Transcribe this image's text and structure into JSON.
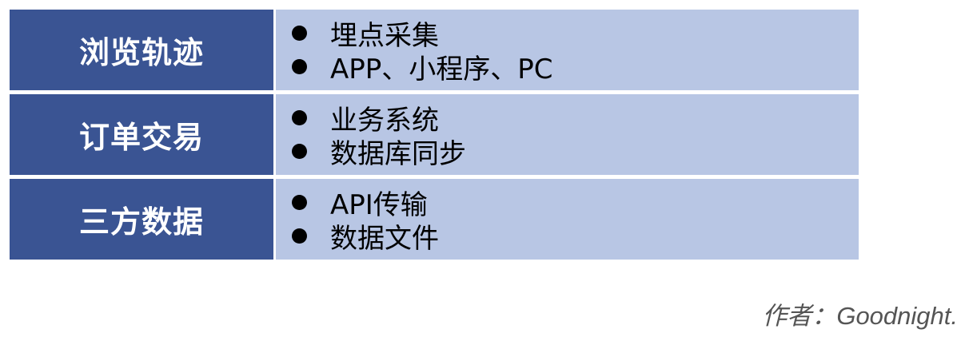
{
  "rows": [
    {
      "category": "浏览轨迹",
      "items": [
        "埋点采集",
        "APP、小程序、PC"
      ]
    },
    {
      "category": "订单交易",
      "items": [
        "业务系统",
        "数据库同步"
      ]
    },
    {
      "category": "三方数据",
      "items": [
        "API传输",
        "数据文件"
      ]
    }
  ],
  "author": "作者：Goodnight.",
  "colors": {
    "category_bg": "#3a5493",
    "items_bg": "#b8c6e4"
  }
}
